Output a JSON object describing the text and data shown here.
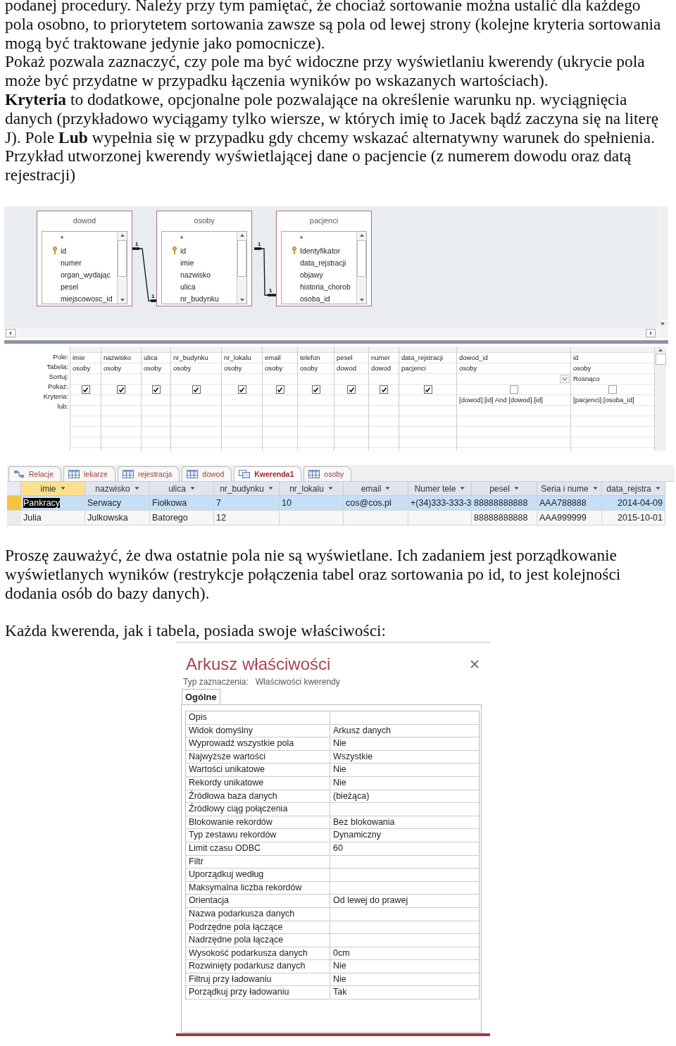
{
  "intro_paragraphs": [
    "podanej procedury. Należy przy tym pamiętać, że chociaż sortowanie można ustalić dla każdego pola osobno, to priorytetem sortowania zawsze są pola od lewej strony (kolejne kryteria sortowania mogą być traktowane jedynie jako pomocnicze).",
    "Pokaż pozwala zaznaczyć, czy pole ma być widoczne przy wyświetlaniu kwerendy (ukrycie pola może być przydatne w przypadku łączenia wyników po wskazanych wartościach).",
    "**Kryteria** to dodatkowe, opcjonalne pole pozwalające na określenie warunku np. wyciągnięcia danych (przykładowo wyciągamy tylko wiersze, w których imię to Jacek bądź zaczyna się na literę J). Pole **Lub** wypełnia się w przypadku gdy chcemy wskazać alternatywny warunek do spełnienia.",
    "Przykład utworzonej kwerendy wyświetlającej dane o pacjencie (z numerem dowodu oraz datą rejestracji)"
  ],
  "query_designer": {
    "tables": [
      {
        "title": "dowod",
        "fields": [
          {
            "name": "*",
            "key": false
          },
          {
            "name": "id",
            "key": true
          },
          {
            "name": "numer",
            "key": false
          },
          {
            "name": "organ_wydając",
            "key": false
          },
          {
            "name": "pesel",
            "key": false
          },
          {
            "name": "miejscowosc_id",
            "key": false
          }
        ]
      },
      {
        "title": "osoby",
        "fields": [
          {
            "name": "*",
            "key": false
          },
          {
            "name": "id",
            "key": true
          },
          {
            "name": "imie",
            "key": false
          },
          {
            "name": "nazwisko",
            "key": false
          },
          {
            "name": "ulica",
            "key": false
          },
          {
            "name": "nr_budynku",
            "key": false
          }
        ]
      },
      {
        "title": "pacjenci",
        "fields": [
          {
            "name": "*",
            "key": false
          },
          {
            "name": "Identyfikator",
            "key": true
          },
          {
            "name": "data_rejstracji",
            "key": false
          },
          {
            "name": "objawy",
            "key": false
          },
          {
            "name": "historia_chorob",
            "key": false
          },
          {
            "name": "osoba_id",
            "key": false
          }
        ]
      }
    ],
    "relations": [
      {
        "from_label": "1",
        "to_label": "1"
      },
      {
        "from_label": "1",
        "to_label": "1"
      }
    ],
    "row_labels": [
      "Pole:",
      "Tabela:",
      "Sortuj:",
      "Pokaż:",
      "Kryteria:",
      "lub:"
    ],
    "columns": [
      {
        "field": "imie",
        "table": "osoby",
        "show": true,
        "focused": false
      },
      {
        "field": "nazwisko",
        "table": "osoby",
        "show": true,
        "focused": false
      },
      {
        "field": "ulica",
        "table": "osoby",
        "show": true,
        "focused": false
      },
      {
        "field": "nr_budynku",
        "table": "osoby",
        "show": true,
        "focused": false
      },
      {
        "field": "nr_lokalu",
        "table": "osoby",
        "show": true,
        "focused": false
      },
      {
        "field": "email",
        "table": "osoby",
        "show": true,
        "focused": false
      },
      {
        "field": "telefon",
        "table": "osoby",
        "show": true,
        "focused": false
      },
      {
        "field": "pesel",
        "table": "dowod",
        "show": true,
        "focused": false
      },
      {
        "field": "numer",
        "table": "dowod",
        "show": true,
        "focused": false
      },
      {
        "field": "data_rejstracji",
        "table": "pacjenci",
        "show": true,
        "focused": false
      },
      {
        "field": "dowod_id",
        "table": "osoby",
        "show": false,
        "focused": true,
        "criteria": "[dowod].[id] And [dowod].[id]"
      },
      {
        "field": "id",
        "table": "osoby",
        "sort": "Rosnąco",
        "show": false,
        "focused": false,
        "criteria": "[pacjenci].[osoba_id]"
      }
    ]
  },
  "datasheet": {
    "tabs": [
      {
        "label": "Relacje",
        "kind": "relations",
        "selected": false
      },
      {
        "label": "lekarze",
        "kind": "table",
        "selected": false
      },
      {
        "label": "rejestracja",
        "kind": "table",
        "selected": false
      },
      {
        "label": "dowod",
        "kind": "table",
        "selected": false
      },
      {
        "label": "Kwerenda1",
        "kind": "query",
        "selected": true
      },
      {
        "label": "osoby",
        "kind": "table",
        "selected": false
      }
    ],
    "columns": [
      {
        "label": "imie",
        "selected": true
      },
      {
        "label": "nazwisko",
        "selected": false
      },
      {
        "label": "ulica",
        "selected": false
      },
      {
        "label": "nr_budynku",
        "selected": false
      },
      {
        "label": "nr_lokalu",
        "selected": false
      },
      {
        "label": "email",
        "selected": false
      },
      {
        "label": "Numer tele",
        "selected": false
      },
      {
        "label": "pesel",
        "selected": false
      },
      {
        "label": "Seria i nume",
        "selected": false
      },
      {
        "label": "data_rejstra",
        "selected": false
      }
    ],
    "rows": [
      {
        "selected": true,
        "cells": [
          "Pankracy",
          "Serwacy",
          "Fiołkowa",
          "7",
          "10",
          "cos@cos.pl",
          "+(34)333-333-3",
          "88888888888",
          "AAA788888",
          "2014-04-09"
        ]
      },
      {
        "selected": false,
        "cells": [
          "Julia",
          "Julkowska",
          "Batorego",
          "12",
          "",
          "",
          "",
          "88888888888",
          "AAA999999",
          "2015-10-01"
        ]
      }
    ]
  },
  "outro_paragraphs": [
    "Proszę zauważyć, że dwa ostatnie pola nie są wyświetlane. Ich zadaniem jest porządkowanie wyświetlanych wyników (restrykcje połączenia tabel oraz sortowania po id, to jest kolejności dodania osób do bazy danych).",
    "Każda kwerenda, jak i tabela, posiada swoje właściwości:"
  ],
  "property_sheet": {
    "title": "Arkusz właściwości",
    "selection_label": "Typ zaznaczenia:",
    "selection_value": "Właściwości kwerendy",
    "tabs": [
      {
        "label": "Ogólne",
        "selected": true
      }
    ],
    "rows": [
      {
        "name": "Opis"
      },
      {
        "name": "Widok domyślny",
        "value": "Arkusz danych"
      },
      {
        "name": "Wyprowadź wszystkie pola",
        "value": "Nie"
      },
      {
        "name": "Najwyższe wartości",
        "value": "Wszystkie"
      },
      {
        "name": "Wartości unikatowe",
        "value": "Nie"
      },
      {
        "name": "Rekordy unikatowe",
        "value": "Nie"
      },
      {
        "name": "Źródłowa baza danych",
        "value": "(bieżąca)"
      },
      {
        "name": "Źródłowy ciąg połączenia"
      },
      {
        "name": "Blokowanie rekordów",
        "value": "Bez blokowania"
      },
      {
        "name": "Typ zestawu rekordów",
        "value": "Dynamiczny"
      },
      {
        "name": "Limit czasu ODBC",
        "value": "60"
      },
      {
        "name": "Filtr"
      },
      {
        "name": "Uporządkuj według"
      },
      {
        "name": "Maksymalna liczba rekordów"
      },
      {
        "name": "Orientacja",
        "value": "Od lewej do prawej"
      },
      {
        "name": "Nazwa podarkusza danych"
      },
      {
        "name": "Podrzędne pola łączące"
      },
      {
        "name": "Nadrzędne pola łączące"
      },
      {
        "name": "Wysokość podarkusza danych",
        "value": "0cm"
      },
      {
        "name": "Rozwinięty podarkusz danych",
        "value": "Nie"
      },
      {
        "name": "Filtruj przy ładowaniu",
        "value": "Nie"
      },
      {
        "name": "Porządkuj przy ładowaniu",
        "value": "Tak"
      }
    ]
  }
}
